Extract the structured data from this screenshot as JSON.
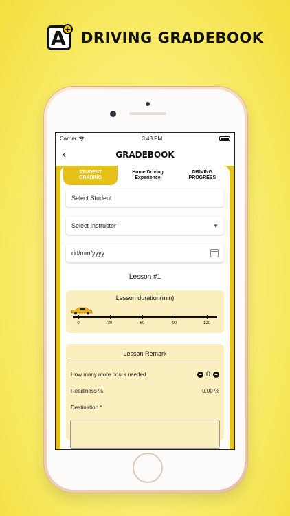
{
  "brand": {
    "title": "DRIVING GRADEBOOK",
    "logo_letter": "A",
    "logo_plus": "+"
  },
  "status": {
    "carrier": "Carrier",
    "time": "3:48 PM"
  },
  "nav": {
    "back_icon": "‹",
    "title": "GRADEBOOK"
  },
  "tabs": [
    {
      "line1": "STUDENT",
      "line2": "GRADING"
    },
    {
      "line1": "Home Driving",
      "line2": "Experience"
    },
    {
      "line1": "DRIVING",
      "line2": "PROGRESS"
    }
  ],
  "form": {
    "student_placeholder": "Select Student",
    "instructor_placeholder": "Select Instructor",
    "date_placeholder": "dd/mm/yyyy"
  },
  "lesson_title": "Lesson #1",
  "duration": {
    "title": "Lesson duration(min)",
    "ticks": [
      "0",
      "30",
      "60",
      "90",
      "120"
    ],
    "value": 0
  },
  "remark": {
    "title": "Lesson Remark",
    "hours_label": "How many more hours needed",
    "hours_value": "0",
    "readiness_label": "Readiness %",
    "readiness_value": "0.00 %",
    "destination_label": "Destination *"
  },
  "colors": {
    "accent": "#e6c11a",
    "panel": "#fbefc0",
    "car": "#f0b21a"
  }
}
